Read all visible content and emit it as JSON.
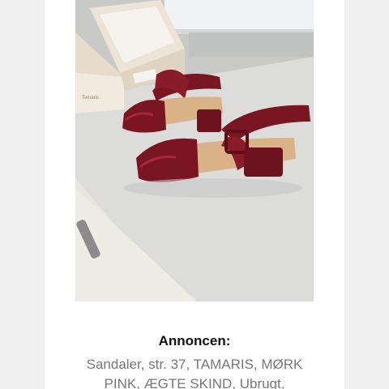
{
  "ad": {
    "heading": "Annoncen:",
    "description_line1": "Sandaler, str. 37, TAMARIS, MØRK",
    "description_line2": "PINK, ÆGTE SKIND, Ubrugt,"
  },
  "photo": {
    "subject": "burgundy block-heel sandals on a counter next to a Tamaris shoebox",
    "box_brand_text": "Tamaris"
  },
  "colors": {
    "sandal": "#7a1622",
    "sandal_highlight": "#a8283a",
    "counter": "#d8d8d8",
    "box": "#ece4d6",
    "insole": "#d9b287"
  }
}
